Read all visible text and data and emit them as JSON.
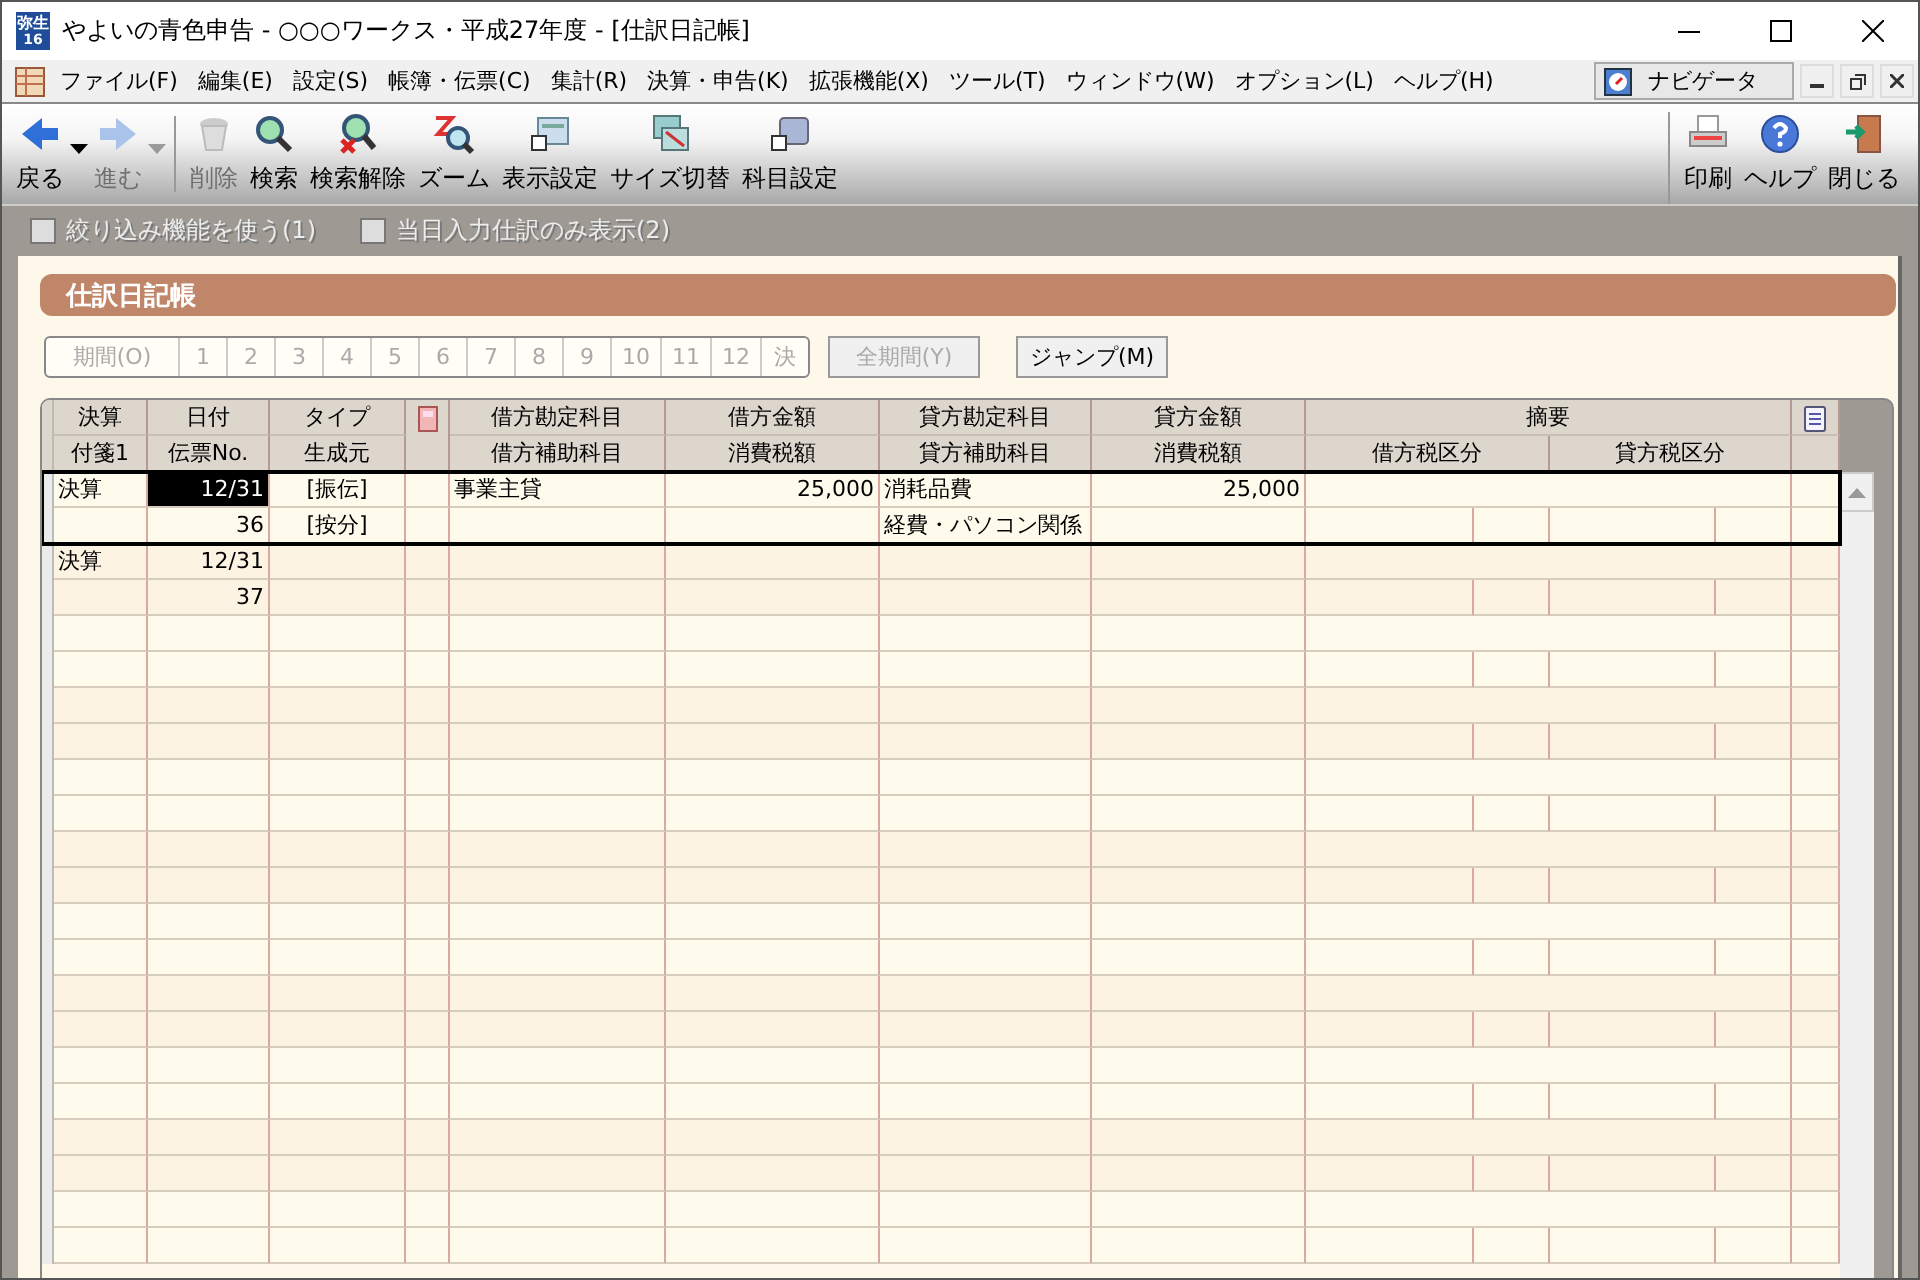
{
  "window": {
    "title": "やよいの青色申告 - ○○○ワークス・平成27年度 - [仕訳日記帳]",
    "logo_text": [
      "弥生",
      "16"
    ]
  },
  "menu": [
    "ファイル(F)",
    "編集(E)",
    "設定(S)",
    "帳簿・伝票(C)",
    "集計(R)",
    "決算・申告(K)",
    "拡張機能(X)",
    "ツール(T)",
    "ウィンドウ(W)",
    "オプション(L)",
    "ヘルプ(H)"
  ],
  "navigator": {
    "label": "ナビゲータ"
  },
  "toolbar": [
    {
      "kind": "back",
      "label": "戻る",
      "disabled": false
    },
    {
      "kind": "forward",
      "label": "進む",
      "disabled": true
    },
    {
      "kind": "delete",
      "label": "削除",
      "disabled": true
    },
    {
      "kind": "search",
      "label": "検索",
      "disabled": false
    },
    {
      "kind": "clear-search",
      "label": "検索解除",
      "disabled": false
    },
    {
      "kind": "zoom",
      "label": "ズーム",
      "disabled": false
    },
    {
      "kind": "display",
      "label": "表示設定",
      "disabled": false
    },
    {
      "kind": "resize",
      "label": "サイズ切替",
      "disabled": false
    },
    {
      "kind": "accounts",
      "label": "科目設定",
      "disabled": false
    }
  ],
  "toolbar_right": [
    {
      "kind": "print",
      "label": "印刷"
    },
    {
      "kind": "help",
      "label": "ヘルプ"
    },
    {
      "kind": "close",
      "label": "閉じる"
    }
  ],
  "options": [
    {
      "label": "絞り込み機能を使う(1)",
      "checked": false,
      "disabled": true
    },
    {
      "label": "当日入力仕訳のみ表示(2)",
      "checked": false,
      "disabled": true
    }
  ],
  "panel_title": "仕訳日記帳",
  "period": {
    "label": "期間(O)",
    "months": [
      "1",
      "2",
      "3",
      "4",
      "5",
      "6",
      "7",
      "8",
      "9",
      "10",
      "11",
      "12",
      "決"
    ],
    "all_button": "全期間(Y)",
    "jump_button": "ジャンプ(M)"
  },
  "table": {
    "columns_top": [
      "決算",
      "日付",
      "タイプ",
      "借方勘定科目",
      "借方金額",
      "貸方勘定科目",
      "貸方金額",
      "摘要"
    ],
    "columns_bottom": [
      "付箋1",
      "伝票No.",
      "生成元",
      "借方補助科目",
      "消費税額",
      "貸方補助科目",
      "消費税額",
      "借方税区分",
      "貸方税区分"
    ],
    "rows": [
      {
        "selected": true,
        "settlement": "決算",
        "date": "12/31",
        "number": "36",
        "type": "[振伝]",
        "source": "[按分]",
        "debit_account": "事業主貸",
        "debit_amount": "25,000",
        "credit_account": "消耗品費",
        "credit_sub": "経費・パソコン関係",
        "credit_amount": "25,000"
      },
      {
        "selected": false,
        "settlement": "決算",
        "date": "12/31",
        "number": "37"
      }
    ]
  }
}
